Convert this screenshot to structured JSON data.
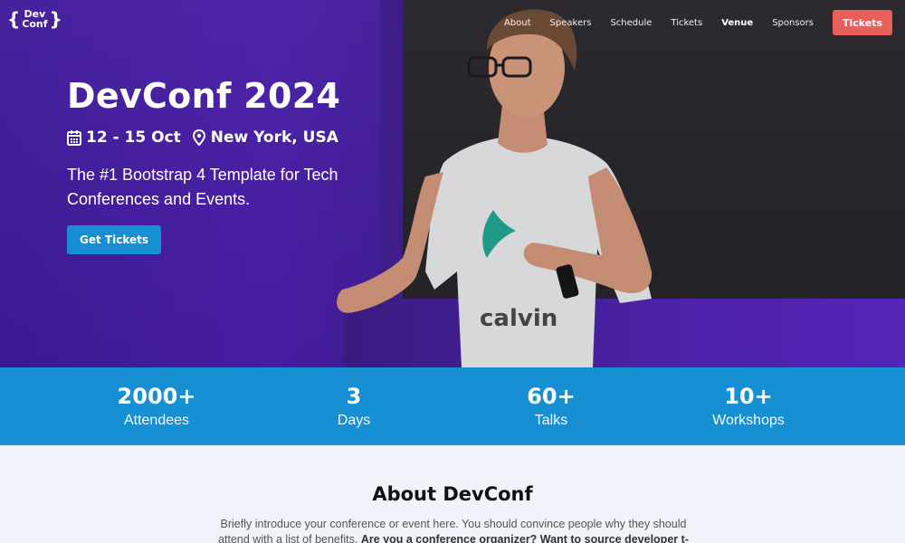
{
  "brand": {
    "open_brace": "{",
    "line1": "Dev",
    "line2": "Conf",
    "close_brace": "}"
  },
  "nav": {
    "links": [
      "About",
      "Speakers",
      "Schedule",
      "Tickets",
      "Venue",
      "Sponsors"
    ],
    "active": "Venue",
    "cta": "Tickets"
  },
  "hero": {
    "title": "DevConf 2024",
    "dates": "12 - 15 Oct",
    "location": "New York, USA",
    "subtitle": "The #1 Bootstrap 4 Template for Tech Conferences and Events.",
    "button": "Get Tickets",
    "icons": {
      "date": "calendar-icon",
      "location": "map-marker-icon"
    }
  },
  "stats": [
    {
      "value": "2000+",
      "label": "Attendees"
    },
    {
      "value": "3",
      "label": "Days"
    },
    {
      "value": "60+",
      "label": "Talks"
    },
    {
      "value": "10+",
      "label": "Workshops"
    }
  ],
  "about": {
    "title": "About DevConf",
    "text_plain": "Briefly introduce your conference or event here. You should convince people why they should attend with a list of benefits.",
    "text_bold": "Are you a conference organizer? Want to source developer t-shirts as part of"
  },
  "colors": {
    "accent": "#168fd3",
    "cta": "#e9605a",
    "hero_purple": "#4a1fa8",
    "about_bg": "#eef4f9"
  }
}
